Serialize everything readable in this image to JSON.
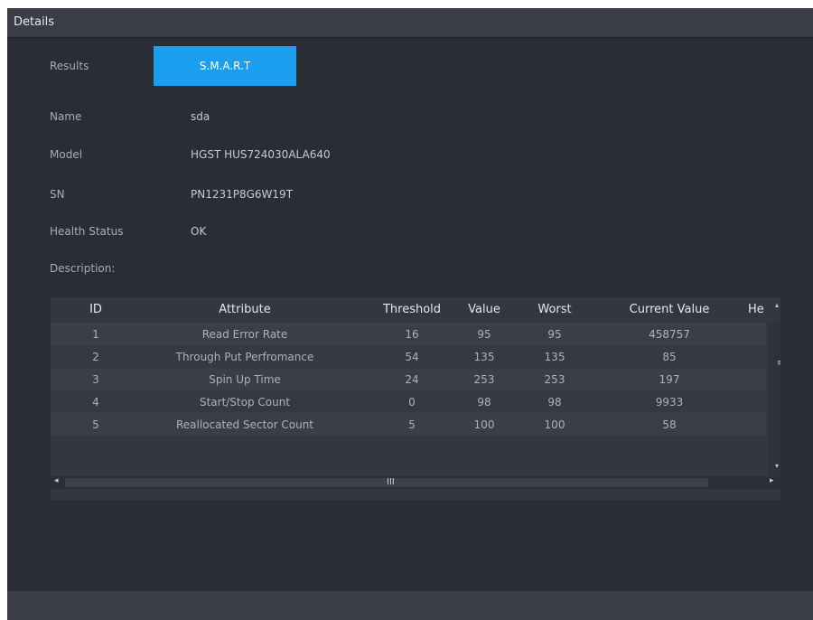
{
  "window": {
    "title": "Details"
  },
  "tabs": [
    {
      "label": "Results",
      "active": false
    },
    {
      "label": "S.M.A.R.T",
      "active": true
    }
  ],
  "fields": {
    "name": {
      "label": "Name",
      "value": "sda"
    },
    "model": {
      "label": "Model",
      "value": "HGST HUS724030ALA640"
    },
    "sn": {
      "label": "SN",
      "value": "PN1231P8G6W19T"
    },
    "health": {
      "label": "Health Status",
      "value": "OK"
    },
    "description": {
      "label": "Description:"
    }
  },
  "table": {
    "headers": [
      "ID",
      "Attribute",
      "Threshold",
      "Value",
      "Worst",
      "Current Value",
      "He"
    ],
    "rows": [
      [
        "1",
        "Read Error Rate",
        "16",
        "95",
        "95",
        "458757"
      ],
      [
        "2",
        "Through Put Perfromance",
        "54",
        "135",
        "135",
        "85"
      ],
      [
        "3",
        "Spin Up Time",
        "24",
        "253",
        "253",
        "197"
      ],
      [
        "4",
        "Start/Stop Count",
        "0",
        "98",
        "98",
        "9933"
      ],
      [
        "5",
        "Reallocated Sector Count",
        "5",
        "100",
        "100",
        "58"
      ]
    ]
  },
  "scroll": {
    "grip_v": "≡",
    "grip_h": "III",
    "left": "◂",
    "right": "▸",
    "up": "▴",
    "down": "▾"
  },
  "colors": {
    "accent": "#1a9ff0",
    "window_bg": "#2a2d33",
    "header_bg": "#3a3d43"
  }
}
